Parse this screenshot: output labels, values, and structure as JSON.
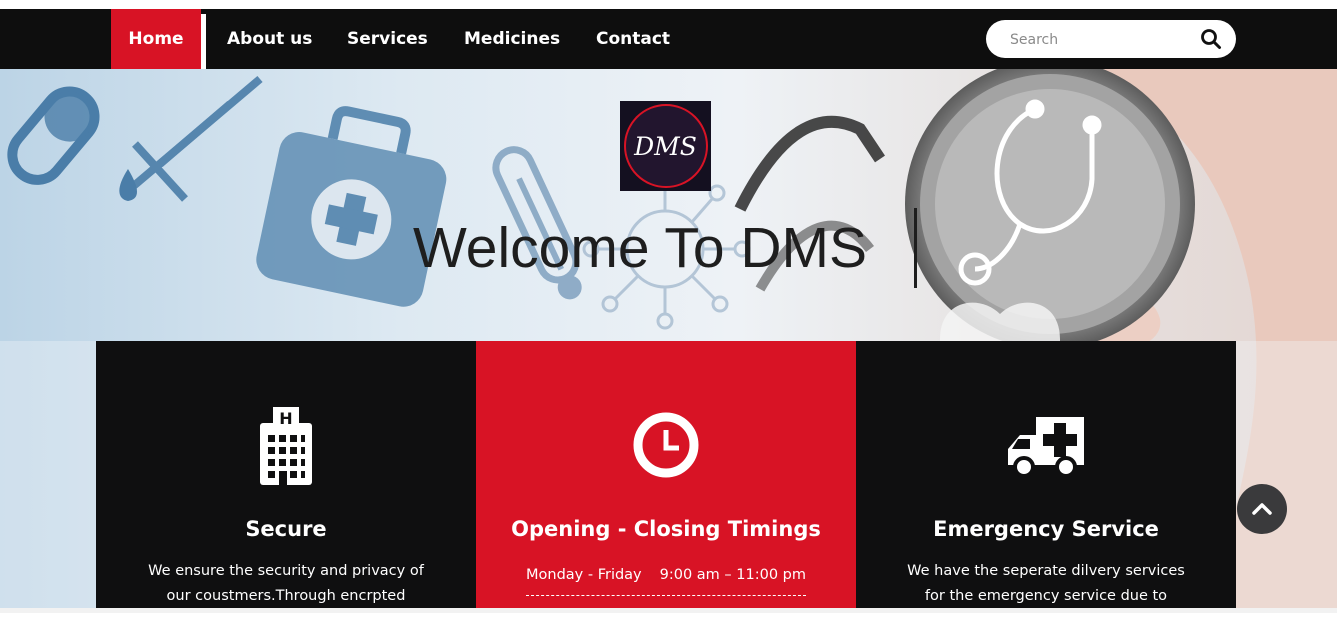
{
  "nav": {
    "items": [
      {
        "label": "Home",
        "active": true
      },
      {
        "label": "About us",
        "active": false
      },
      {
        "label": "Services",
        "active": false
      },
      {
        "label": "Medicines",
        "active": false
      },
      {
        "label": "Contact",
        "active": false
      }
    ],
    "search_placeholder": "Search",
    "active_color": "#d81325",
    "bar_color": "#0e0e0e"
  },
  "hero": {
    "logo_text": "DMS",
    "title": "Welcome To DMS"
  },
  "cards": [
    {
      "icon": "hospital-icon",
      "title": "Secure",
      "text_lines": [
        "We ensure the security and privacy of",
        "our coustmers.Through encrpted"
      ]
    },
    {
      "icon": "clock-icon",
      "title": "Opening - Closing Timings",
      "day": "Monday - Friday",
      "time": "9:00 am – 11:00 pm"
    },
    {
      "icon": "ambulance-icon",
      "title": "Emergency Service",
      "text_lines": [
        "We have the seperate dilvery services",
        "for the emergency service due to which"
      ]
    }
  ],
  "scroll_top": {
    "icon": "chevron-up-icon"
  }
}
